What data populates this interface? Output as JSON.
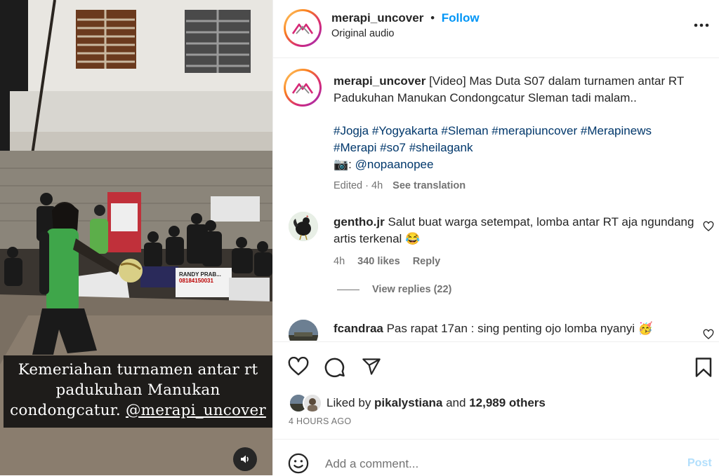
{
  "post": {
    "username": "merapi_uncover",
    "separator": "•",
    "follow_label": "Follow",
    "audio": "Original audio",
    "more_icon": "more-horizontal-icon"
  },
  "media": {
    "overlay_line1": "Kemeriahan turnamen antar rt",
    "overlay_line2": "padukuhan Manukan",
    "overlay_line3": "condongcatur. ",
    "overlay_mention": "@merapi_uncover",
    "banner_text": "RANDY PRAB...",
    "banner_number": "08184150031",
    "sound_icon": "speaker-icon"
  },
  "caption": {
    "username": "merapi_uncover",
    "text": " [Video] Mas Duta S07 dalam turnamen antar RT Padukuhan Manukan Condongcatur Sleman tadi malam..",
    "hashtags_line1": "#Jogja #Yogyakarta #Sleman #merapiuncover #Merapinews",
    "hashtags_line2": "#Merapi #so7 #sheilagank",
    "camera_emoji": "📷",
    "credit_sep": ": ",
    "credit_mention": "@nopaanopee",
    "edited": "Edited · 4h",
    "see_translation": "See translation"
  },
  "comments": [
    {
      "username": "gentho.jr",
      "text": " Salut buat warga setempat, lomba antar RT aja ngundang artis terkenal",
      "emoji": "😂",
      "time": "4h",
      "likes": "340 likes",
      "reply": "Reply",
      "view_replies": "View replies (22)"
    },
    {
      "username": "fcandraa",
      "text": " Pas rapat 17an : sing penting ojo lomba nyanyi",
      "emoji": "🥳"
    }
  ],
  "liked_by": {
    "prefix": "Liked by ",
    "user": "pikalystiana",
    "suffix": " and ",
    "others": "12,989 others"
  },
  "timestamp": "4 HOURS AGO",
  "comment_box": {
    "placeholder": "Add a comment...",
    "post_label": "Post"
  },
  "colors": {
    "link": "#00376b",
    "accent": "#0095f6",
    "muted": "#737373"
  }
}
